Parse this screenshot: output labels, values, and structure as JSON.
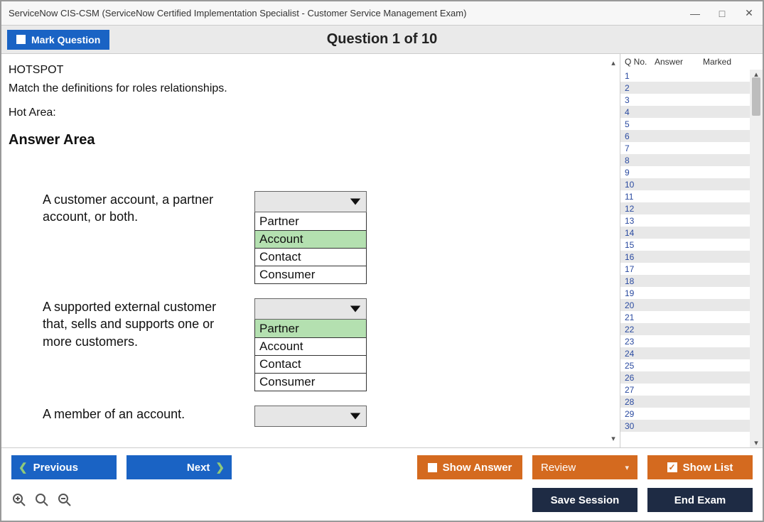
{
  "window_title": "ServiceNow CIS-CSM (ServiceNow Certified Implementation Specialist - Customer Service Management Exam)",
  "header": {
    "mark_question_label": "Mark Question",
    "question_title": "Question 1 of 10"
  },
  "content": {
    "hotspot_label": "HOTSPOT",
    "prompt": "Match the definitions for roles relationships.",
    "hot_area_label": "Hot Area:",
    "answer_area_title": "Answer Area",
    "rows": [
      {
        "definition": "A customer account, a partner account, or both.",
        "options": [
          "Partner",
          "Account",
          "Contact",
          "Consumer"
        ],
        "selected_index": 1
      },
      {
        "definition": "A supported external customer that, sells and supports one or more customers.",
        "options": [
          "Partner",
          "Account",
          "Contact",
          "Consumer"
        ],
        "selected_index": 0
      },
      {
        "definition": "A member of an account.",
        "options": [],
        "selected_index": null
      }
    ]
  },
  "sidebar": {
    "headers": {
      "qno": "Q No.",
      "answer": "Answer",
      "marked": "Marked"
    },
    "count": 30
  },
  "footer": {
    "previous": "Previous",
    "next": "Next",
    "show_answer": "Show Answer",
    "review": "Review",
    "show_list": "Show List",
    "save_session": "Save Session",
    "end_exam": "End Exam"
  }
}
